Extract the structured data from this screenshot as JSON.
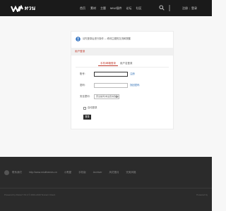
{
  "header": {
    "logo_text": "ทวน",
    "nav": [
      "首页",
      "素材",
      "主题",
      "MIUI插件",
      "论坛",
      "社区"
    ],
    "login": "注册",
    "register": "登录"
  },
  "card": {
    "notice": "请先登录后进行操作 --- 修改主题的交流和提醒",
    "section_title": "用户登录",
    "tabs": [
      "手机/邮箱登录",
      "用户名登录"
    ],
    "username_label": "账号:",
    "username_value": "",
    "password_label": "密码:",
    "password_value": "",
    "register_link": "注册",
    "forgot_link": "找回密码",
    "question_label": "安全提问:",
    "question_selected": "安全提问(未设置请忽略)",
    "remember_label": "自动登录",
    "login_button": "登录"
  },
  "footer": {
    "links": [
      "联系我们",
      "http://www.miuithemes.cn",
      "小黑屋",
      "手机版",
      "Archiver",
      "风花雪月",
      "完美风格"
    ],
    "copyright": "Powered by Discuz! X3.4 © 2001-2019 Tencent Cloud.",
    "powered": "Powered by",
    "colors": {
      "accent": "#c0392b",
      "header_bg": "#1a1a1a",
      "footer_bg": "#2b2b2b"
    }
  }
}
